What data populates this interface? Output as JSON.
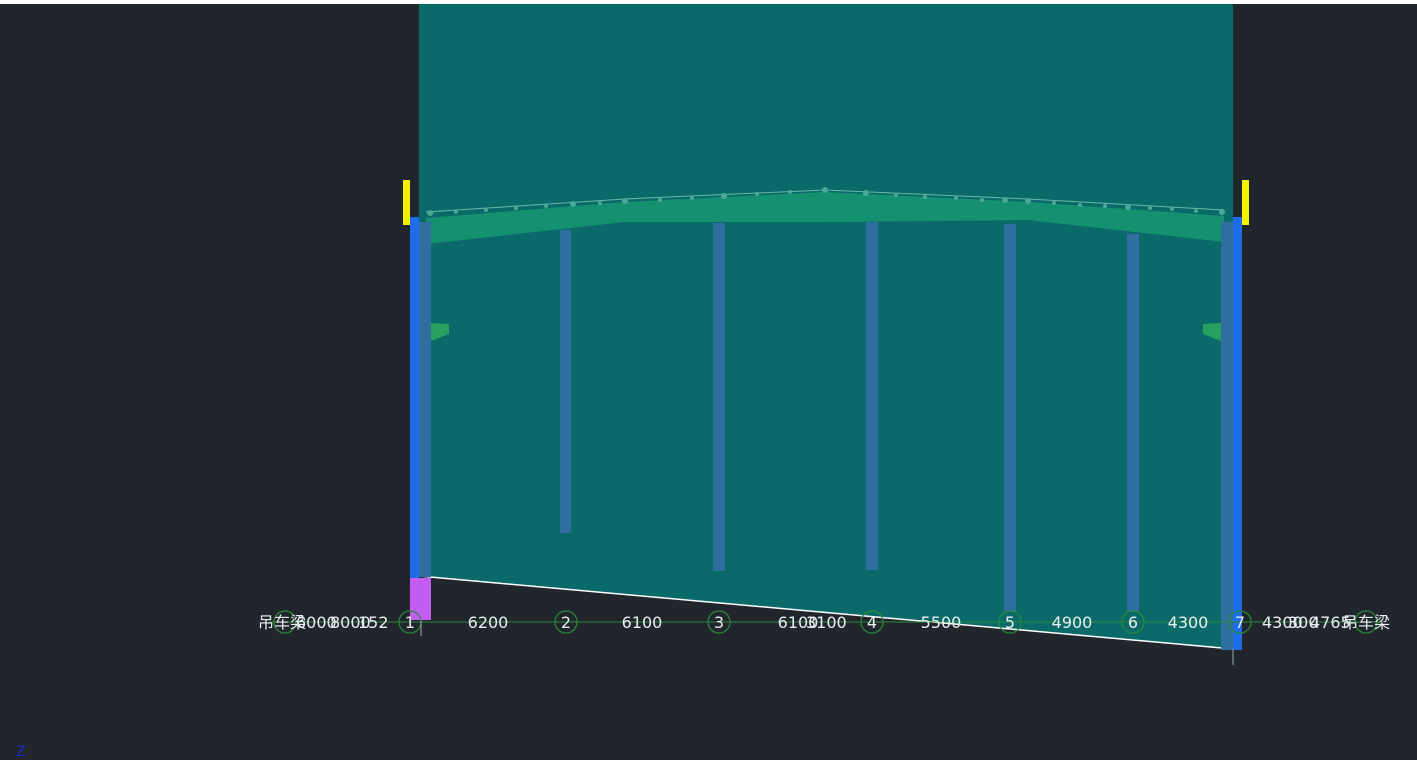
{
  "viewport": {
    "background": "#21262d",
    "wall_fill": "#0a6a6a",
    "roof_color": "#159070",
    "column_color": "#2f6fa0",
    "edge_column_color": "#1e6ce8",
    "marker_color": "#f2f200",
    "grid_color": "#2a8a3a",
    "base_color": "#c35cf0"
  },
  "axis_indicator": "Z",
  "grid": {
    "bubbles": [
      "1",
      "2",
      "3",
      "4",
      "5",
      "6",
      "7"
    ],
    "spacings": [
      "6200",
      "6100",
      "6100",
      "5500",
      "4900",
      "4300"
    ],
    "overlap_labels": {
      "left": "吊车梁",
      "left_stack": "6000",
      "left_stack_2": "8000",
      "left_stack_3": "152",
      "mid_overlap": "3100",
      "right_stack": "4300",
      "right_stack_2": "300",
      "right_stack_3": "4765",
      "right": "吊车梁"
    }
  }
}
